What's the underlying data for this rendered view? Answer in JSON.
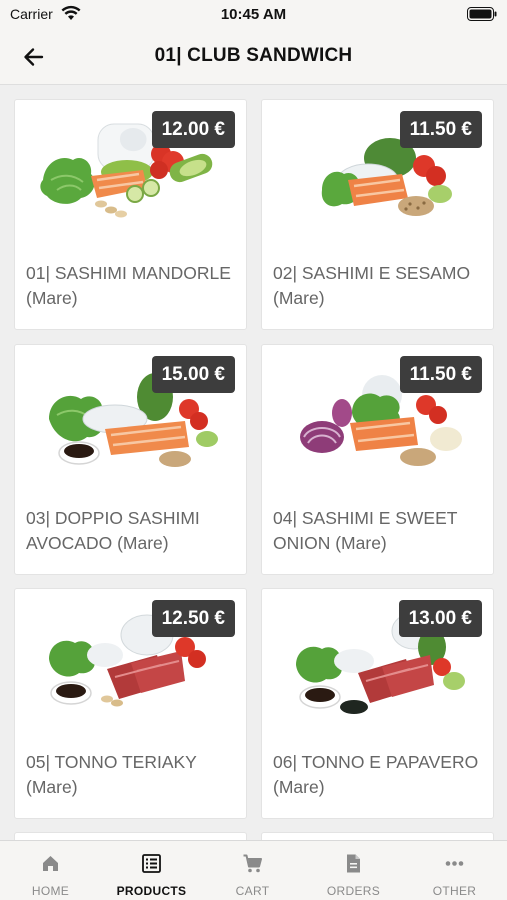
{
  "status_bar": {
    "carrier": "Carrier",
    "time": "10:45 AM"
  },
  "nav": {
    "title": "01| CLUB SANDWICH"
  },
  "products": [
    {
      "price": "12.00 €",
      "name": "01| SASHIMI MANDORLE (Mare)",
      "image": "salmon-almond-bowl"
    },
    {
      "price": "11.50 €",
      "name": "02| SASHIMI E SESAMO (Mare)",
      "image": "salmon-sesame-bowl"
    },
    {
      "price": "15.00 €",
      "name": "03| DOPPIO SASHIMI AVOCADO (Mare)",
      "image": "salmon-avocado-bowl"
    },
    {
      "price": "11.50 €",
      "name": "04| SASHIMI E SWEET ONION (Mare)",
      "image": "salmon-onion-bowl"
    },
    {
      "price": "12.50 €",
      "name": "05| TONNO TERIAKY (Mare)",
      "image": "tuna-teriyaki-bowl"
    },
    {
      "price": "13.00 €",
      "name": "06| TONNO E PAPAVERO (Mare)",
      "image": "tuna-poppy-bowl"
    }
  ],
  "tabs": [
    {
      "label": "HOME",
      "icon": "home-icon",
      "active": false
    },
    {
      "label": "PRODUCTS",
      "icon": "list-icon",
      "active": true
    },
    {
      "label": "CART",
      "icon": "cart-icon",
      "active": false
    },
    {
      "label": "ORDERS",
      "icon": "document-icon",
      "active": false
    },
    {
      "label": "OTHER",
      "icon": "more-icon",
      "active": false
    }
  ],
  "colors": {
    "price_badge": "#3d3d3d",
    "product_name": "#666666",
    "tab_inactive": "#8a8a8a",
    "tab_active": "#111111"
  }
}
